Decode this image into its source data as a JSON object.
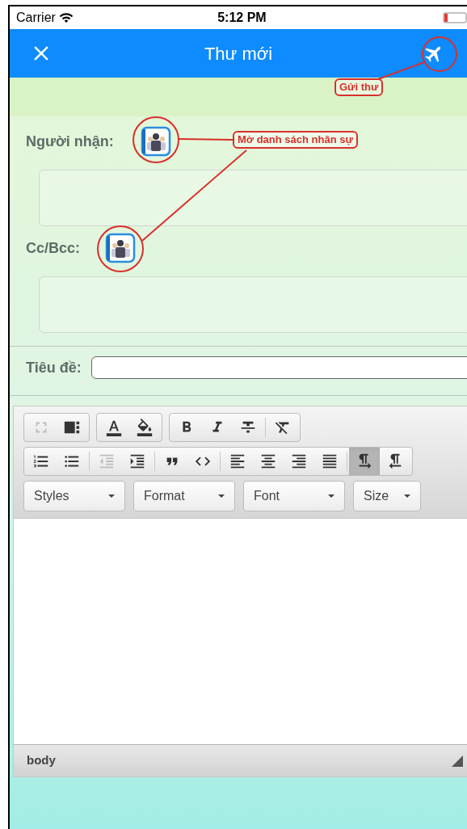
{
  "status_bar": {
    "carrier": "Carrier",
    "time": "5:12 PM"
  },
  "nav_bar": {
    "title": "Thư mới"
  },
  "recipients": [
    {
      "label": "Người nhận:"
    },
    {
      "label": "Cc/Bcc:"
    }
  ],
  "subject": {
    "label": "Tiêu đề:"
  },
  "toolbar": {
    "groups": [
      [
        {
          "kind": "maximize",
          "disabled": true,
          "selected": false
        },
        {
          "kind": "showblocks",
          "disabled": false,
          "selected": false
        }
      ],
      [
        {
          "kind": "textcolor",
          "disabled": false,
          "selected": false
        },
        {
          "kind": "bgcolor",
          "disabled": false,
          "selected": false
        }
      ],
      [
        {
          "kind": "bold",
          "disabled": false,
          "selected": false
        },
        {
          "kind": "italic",
          "disabled": false,
          "selected": false
        },
        {
          "kind": "strike",
          "disabled": false,
          "selected": false
        },
        {
          "kind": "sep"
        },
        {
          "kind": "removeformat",
          "disabled": false,
          "selected": false
        }
      ],
      [
        {
          "kind": "numbered",
          "disabled": false,
          "selected": false
        },
        {
          "kind": "bulleted",
          "disabled": false,
          "selected": false
        },
        {
          "kind": "sep"
        },
        {
          "kind": "outdent",
          "disabled": true,
          "selected": false
        },
        {
          "kind": "indent",
          "disabled": false,
          "selected": false
        },
        {
          "kind": "sep"
        },
        {
          "kind": "quote",
          "disabled": false,
          "selected": false
        },
        {
          "kind": "div",
          "disabled": false,
          "selected": false
        },
        {
          "kind": "sep"
        },
        {
          "kind": "alignleft",
          "disabled": false,
          "selected": false
        },
        {
          "kind": "aligncenter",
          "disabled": false,
          "selected": false
        },
        {
          "kind": "alignright",
          "disabled": false,
          "selected": false
        },
        {
          "kind": "justify",
          "disabled": false,
          "selected": false
        },
        {
          "kind": "sep"
        },
        {
          "kind": "ltr",
          "disabled": false,
          "selected": true
        },
        {
          "kind": "rtl",
          "disabled": false,
          "selected": false
        }
      ]
    ],
    "dropdowns": [
      "Styles",
      "Format",
      "Font",
      "Size"
    ]
  },
  "editor_footer": {
    "path": "body"
  },
  "annotations": [
    {
      "kind": "send",
      "text": "Gửi thư"
    },
    {
      "kind": "contacts",
      "text": "Mở danh sách nhân sự"
    }
  ]
}
